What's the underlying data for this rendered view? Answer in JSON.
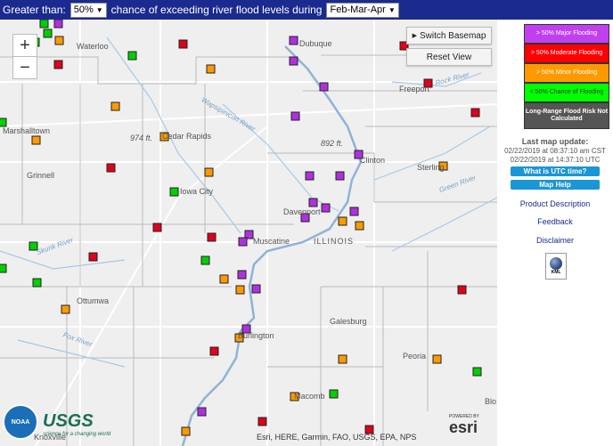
{
  "topbar": {
    "prefix": "Greater than:",
    "threshold": "50%",
    "middle": "chance of exceeding river flood levels during",
    "period": "Feb-Mar-Apr"
  },
  "map": {
    "switch_basemap": "Switch Basemap",
    "reset_view": "Reset View",
    "zoom_in": "+",
    "zoom_out": "−",
    "attribution": "Esri, HERE, Garmin, FAO, USGS, EPA, NPS",
    "esri_logo": "esri",
    "esri_powered": "POWERED BY",
    "usgs_logo": "USGS",
    "usgs_tagline": "science for a changing world",
    "noaa_logo": "NOAA",
    "places": [
      "Waterloo",
      "Dubuque",
      "Freeport",
      "Marshalltown",
      "Cedar Rapids",
      "Grinnell",
      "Iowa City",
      "Clinton",
      "Sterling",
      "Davenport",
      "Muscatine",
      "ILLINOIS",
      "Ottumwa",
      "Galesburg",
      "Burlington",
      "Peoria",
      "Macomb",
      "Knoxville",
      "Blo"
    ],
    "rivers": [
      "Wapsipinicon River",
      "Green River",
      "Skunk River",
      "Fox River",
      "Rock River"
    ],
    "elevations": [
      "974 ft.",
      "892 ft."
    ],
    "marker_colors": {
      "major": "#b030e0",
      "moderate": "#e0001a",
      "minor": "#ff9900",
      "low": "#00d000"
    }
  },
  "legend": {
    "major": "> 50% Major Flooding",
    "moderate": "> 50% Moderate Flooding",
    "minor": "> 50% Minor Flooding",
    "low": "< 50% Chance of Flooding",
    "not_calculated": "Long-Range Flood Risk Not Calculated"
  },
  "sidebar": {
    "last_update_label": "Last map update:",
    "last_update_est": "02/22/2019 at 08:37:10 am CST",
    "last_update_utc": "02/22/2019 at 14:37:10 UTC",
    "utc_button": "What is UTC time?",
    "help_button": "Map Help",
    "product_description": "Product Description",
    "feedback": "Feedback",
    "disclaimer": "Disclaimer",
    "kml_label": "KML"
  }
}
